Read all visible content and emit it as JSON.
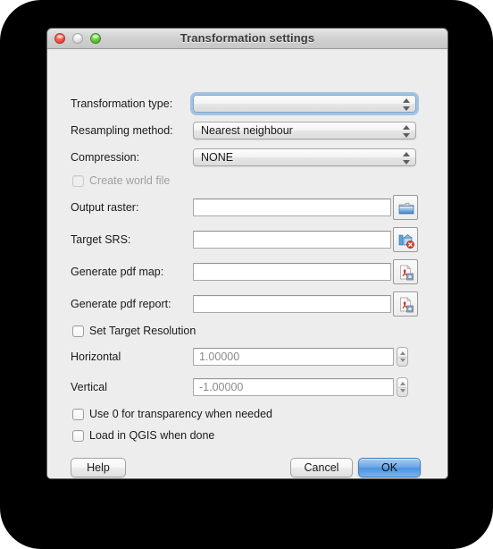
{
  "window": {
    "title": "Transformation settings",
    "traffic_lights": {
      "close": "close-button",
      "minimize": "minimize-button",
      "zoom": "zoom-button"
    }
  },
  "form": {
    "transformation_type": {
      "label": "Transformation type:",
      "value": "",
      "focused": true
    },
    "resampling_method": {
      "label": "Resampling method:",
      "value": "Nearest neighbour"
    },
    "compression": {
      "label": "Compression:",
      "value": "NONE"
    },
    "create_world_file": {
      "label": "Create world file",
      "checked": false,
      "disabled": true
    },
    "output_raster": {
      "label": "Output raster:",
      "value": "",
      "browse_icon": "folder-open-icon"
    },
    "target_srs": {
      "label": "Target SRS:",
      "value": "",
      "browse_icon": "crs-select-icon"
    },
    "generate_pdf_map": {
      "label": "Generate pdf map:",
      "value": "",
      "browse_icon": "pdf-file-icon"
    },
    "generate_pdf_report": {
      "label": "Generate pdf report:",
      "value": "",
      "browse_icon": "pdf-file-icon"
    },
    "set_target_resolution": {
      "label": "Set Target Resolution",
      "checked": false
    },
    "horizontal": {
      "label": "Horizontal",
      "value": "1.00000"
    },
    "vertical": {
      "label": "Vertical",
      "value": "-1.00000"
    },
    "use_zero_transparency": {
      "label": "Use 0 for transparency when needed",
      "checked": false
    },
    "load_in_qgis": {
      "label": "Load in QGIS when done",
      "checked": false
    }
  },
  "buttons": {
    "help": "Help",
    "cancel": "Cancel",
    "ok": "OK"
  },
  "colors": {
    "window_background": "#ededed",
    "titlebar_top": "#e4e4e4",
    "titlebar_bottom": "#c6c6c6",
    "default_button_blue": "#4b93e2",
    "focus_ring": "#6aa0d6",
    "desktop": "#000000"
  }
}
